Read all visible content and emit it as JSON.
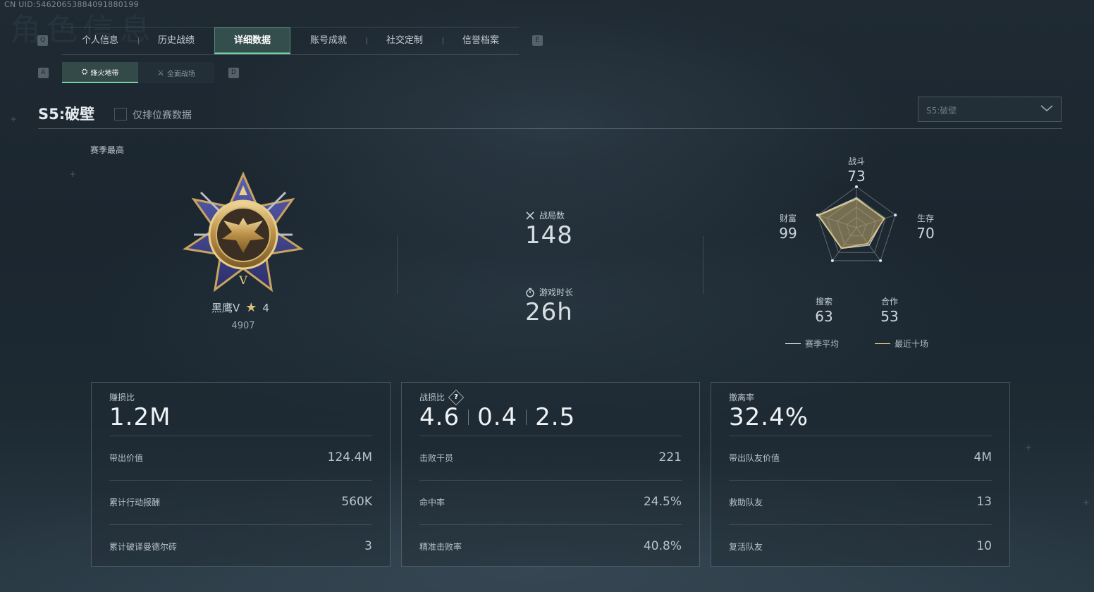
{
  "uid": "CN UID:54620653884091880199",
  "bg_title": "角色信息",
  "hints": {
    "q": "Q",
    "e": "E",
    "a": "A",
    "d": "D"
  },
  "tabs": [
    "个人信息",
    "历史战绩",
    "详细数据",
    "账号成就",
    "社交定制",
    "信誉档案"
  ],
  "active_tab": 2,
  "subtabs": [
    {
      "label": "烽火地带",
      "icon": "extraction-icon"
    },
    {
      "label": "全面战场",
      "icon": "battlefield-icon"
    }
  ],
  "season": {
    "title": "S5:破壁",
    "ranked_only_label": "仅排位赛数据",
    "dropdown_value": "S5:破壁",
    "best_label": "赛季最高"
  },
  "rank": {
    "name": "黑鹰V",
    "stars": "4",
    "score": "4907"
  },
  "stats": {
    "matches_label": "战局数",
    "matches_value": "148",
    "playtime_label": "游戏时长",
    "playtime_value": "26h"
  },
  "radar": {
    "axes": [
      {
        "label": "战斗",
        "value": "73"
      },
      {
        "label": "生存",
        "value": "70"
      },
      {
        "label": "合作",
        "value": "53"
      },
      {
        "label": "搜索",
        "value": "63"
      },
      {
        "label": "财富",
        "value": "99"
      }
    ],
    "season_avg": [
      0.73,
      0.7,
      0.53,
      0.63,
      0.99
    ],
    "recent_ten": [
      0.7,
      0.72,
      0.48,
      0.62,
      0.97
    ],
    "legend": [
      "赛季平均",
      "最近十场"
    ],
    "colors": {
      "season": "#c8ced2",
      "recent": "#d9c27a"
    }
  },
  "cards": [
    {
      "title": "赚损比",
      "big": "1.2M",
      "rows": [
        {
          "k": "带出价值",
          "v": "124.4M"
        },
        {
          "k": "累计行动报酬",
          "v": "560K"
        },
        {
          "k": "累计破译曼德尔砖",
          "v": "3"
        }
      ]
    },
    {
      "title": "战损比",
      "help": "?",
      "big_parts": [
        "4.6",
        "0.4",
        "2.5"
      ],
      "rows": [
        {
          "k": "击败干员",
          "v": "221"
        },
        {
          "k": "命中率",
          "v": "24.5%"
        },
        {
          "k": "精准击败率",
          "v": "40.8%"
        }
      ]
    },
    {
      "title": "撤离率",
      "big": "32.4%",
      "rows": [
        {
          "k": "带出队友价值",
          "v": "4M"
        },
        {
          "k": "救助队友",
          "v": "13"
        },
        {
          "k": "复活队友",
          "v": "10"
        }
      ]
    }
  ]
}
